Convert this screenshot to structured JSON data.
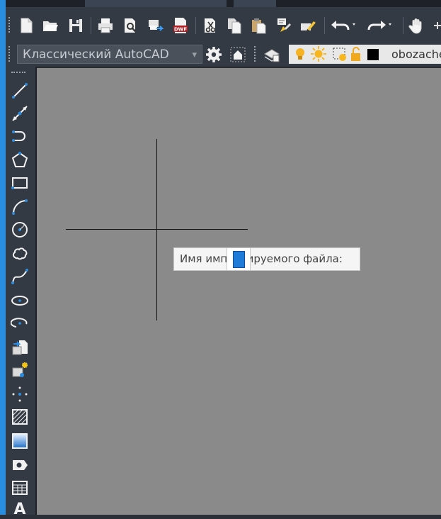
{
  "toolbar_top": {
    "icons": [
      "new-file-icon",
      "open-folder-icon",
      "save-icon",
      "print-icon",
      "print-preview-icon",
      "publish-icon",
      "dwf-icon",
      "cut-icon",
      "copy-icon",
      "paste-icon",
      "match-properties-icon",
      "edit-icon",
      "undo-icon",
      "redo-icon",
      "pan-hand-icon"
    ],
    "dwf_label": "DWF"
  },
  "toolbar_workspace": {
    "workspace_value": "Классический AutoCAD",
    "layer_text": "obozache"
  },
  "sidebar": {
    "tools": [
      "line-icon",
      "construction-line-icon",
      "polyline-icon",
      "polygon-icon",
      "rectangle-icon",
      "arc-icon",
      "circle-icon",
      "revision-cloud-icon",
      "spline-icon",
      "ellipse-icon",
      "ellipse-arc-icon",
      "insert-block-icon",
      "make-block-icon",
      "point-icon",
      "hatch-icon",
      "gradient-icon",
      "region-icon",
      "table-icon",
      "multiline-text-icon"
    ],
    "text_tool_glyph": "A"
  },
  "prompt": {
    "label": "Имя импортируемого файла:"
  },
  "colors": {
    "canvas": "#8a8a8a",
    "toolbar": "#343a44",
    "accent": "#1f7bd8"
  }
}
